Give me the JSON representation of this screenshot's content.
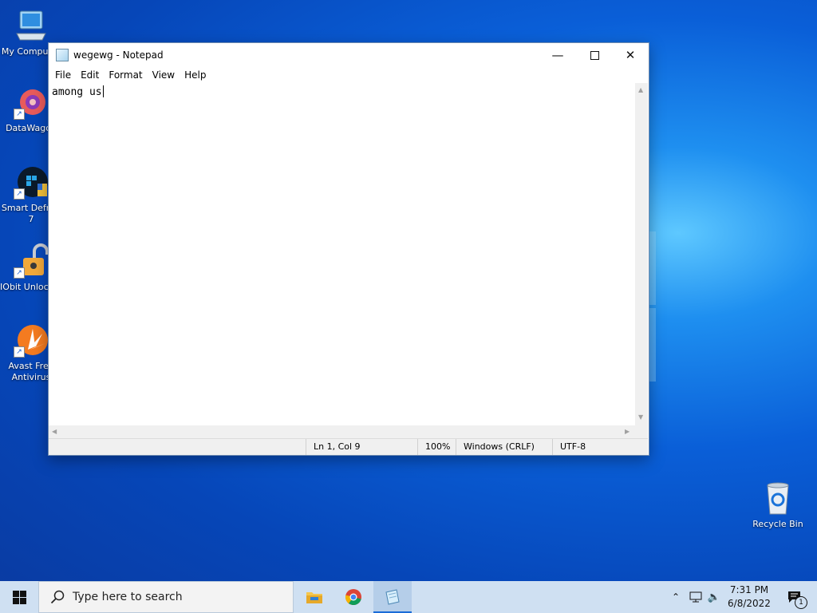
{
  "desktop": {
    "icons": [
      {
        "label": "My Computer"
      },
      {
        "label": "DataWagon"
      },
      {
        "label": "Smart Defrag 7"
      },
      {
        "label": "IObit Unlocker"
      },
      {
        "label": "Avast Free Antivirus"
      },
      {
        "label": "Recycle Bin"
      }
    ]
  },
  "notepad": {
    "title": "wegewg - Notepad",
    "menu": [
      "File",
      "Edit",
      "Format",
      "View",
      "Help"
    ],
    "content": "among us",
    "status": {
      "position": "Ln 1, Col 9",
      "zoom": "100%",
      "line_ending": "Windows (CRLF)",
      "encoding": "UTF-8"
    }
  },
  "taskbar": {
    "search_placeholder": "Type here to search",
    "time": "7:31 PM",
    "date": "6/8/2022",
    "notification_count": "1"
  },
  "colors": {
    "desktop_accent": "#0a5fd8",
    "taskbar": "#cfe0f2",
    "active_app_indicator": "#1a6cd8"
  }
}
